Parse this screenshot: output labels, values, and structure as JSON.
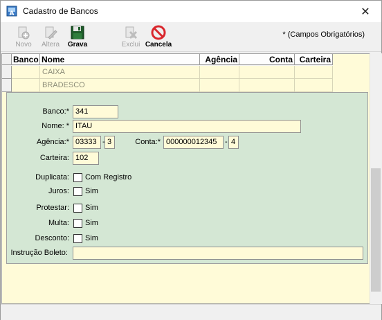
{
  "window": {
    "title": "Cadastro de Bancos"
  },
  "toolbar": {
    "novo": "Novo",
    "altera": "Altera",
    "grava": "Grava",
    "exclui": "Exclui",
    "cancela": "Cancela",
    "required_note": "* (Campos Obrigatórios)"
  },
  "grid": {
    "headers": [
      "Banco",
      "Nome",
      "Agência",
      "Conta",
      "Carteira"
    ],
    "rows": [
      [
        "",
        "CAIXA",
        "",
        "",
        ""
      ],
      [
        "",
        "BRADESCO",
        "",
        "",
        ""
      ]
    ]
  },
  "form": {
    "banco_label": "Banco:*",
    "banco_value": "341",
    "nome_label": "Nome: *",
    "nome_value": "ITAU",
    "agencia_label": "Agência:*",
    "agencia_value": "03333",
    "sep1": "-",
    "agencia_dv": "3",
    "conta_label": "Conta:*",
    "conta_value": "000000012345",
    "sep2": "-",
    "conta_dv": "4",
    "carteira_label": "Carteira:",
    "carteira_value": "102",
    "duplicata_label": "Duplicata:",
    "duplicata_option": "Com Registro",
    "juros_label": "Juros:",
    "juros_option": "Sim",
    "protestar_label": "Protestar:",
    "protestar_option": "Sim",
    "multa_label": "Multa:",
    "multa_option": "Sim",
    "desconto_label": "Desconto:",
    "desconto_option": "Sim",
    "instrucao_label": "Instrução Boleto:",
    "instrucao_value": ""
  },
  "colors": {
    "panel_bg": "#d4e7d4",
    "field_bg": "#fffbd8",
    "cancel_red": "#d9262c",
    "save_green": "#1f5c2a"
  }
}
